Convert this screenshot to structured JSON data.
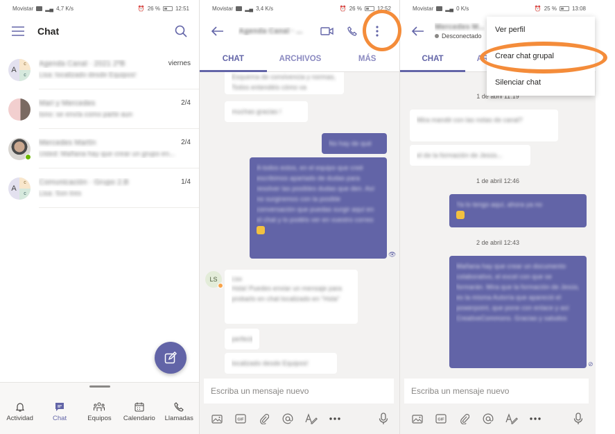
{
  "screen1": {
    "status": {
      "carrier": "Movistar",
      "speed": "4,7 K/s",
      "alarm_battery": "26 %",
      "time": "12:51"
    },
    "header": {
      "title": "Chat",
      "menu_icon": "hamburger-icon",
      "search_icon": "search-icon"
    },
    "chats": [
      {
        "name": "Agenda Canal · 2021 2ºB",
        "preview": "Lisa: localizado desde Equipos!",
        "date": "viernes",
        "avatar": "group",
        "initial": "A",
        "sub": "c"
      },
      {
        "name": "Mari y Mercedes",
        "preview": "tono: se envía como parte aun",
        "date": "2/4",
        "avatar": "photo"
      },
      {
        "name": "Mercedes Martín",
        "preview": "Usted: Mañana hay que crear un grupo en...",
        "date": "2/4",
        "avatar": "photo-online"
      },
      {
        "name": "Comunicación · Grupo 2.B",
        "preview": "Lisa: Son tres",
        "date": "1/4",
        "avatar": "group",
        "initial": "A",
        "sub": "c"
      }
    ],
    "fab_icon": "compose-icon",
    "nav": [
      {
        "label": "Actividad",
        "icon": "bell-icon"
      },
      {
        "label": "Chat",
        "icon": "chat-icon",
        "active": true
      },
      {
        "label": "Equipos",
        "icon": "teams-icon"
      },
      {
        "label": "Calendario",
        "icon": "calendar-icon"
      },
      {
        "label": "Llamadas",
        "icon": "phone-icon"
      }
    ]
  },
  "screen2": {
    "status": {
      "carrier": "Movistar",
      "speed": "3,4 K/s",
      "alarm_battery": "26 %",
      "time": "12:52"
    },
    "header": {
      "contact": "Agenda Canal · ..."
    },
    "tabs": [
      "CHAT",
      "ARCHIVOS",
      "MÁS"
    ],
    "messages": [
      {
        "dir": "in",
        "text": "Esquema de convivencia y normas, Todos entendéis cómo va"
      },
      {
        "dir": "in",
        "text": "muchas gracias !"
      },
      {
        "dir": "out",
        "text": "No hay de qué"
      },
      {
        "dir": "out",
        "text": "A todos estos, en el equipo que creé escribimos apartado de dudas para resolver las posibles dudas que den. Así no surgiremos con la posible conversación que puedas surgir aquí en el chat y lo podéis ver en vuestro correo"
      },
      {
        "sender": "LS",
        "sender_name": "Lisa",
        "dir": "in",
        "text": "Hola! Puedes enviar un mensaje para probarlo en chat localizado en \"Hola\""
      },
      {
        "dir": "in",
        "text": "perfecto"
      },
      {
        "dir": "in",
        "text": "localizado desde Equipos!"
      }
    ],
    "composer": {
      "placeholder": "Escriba un mensaje nuevo"
    }
  },
  "screen3": {
    "status": {
      "carrier": "Movistar",
      "speed": "0 K/s",
      "alarm_battery": "25 %",
      "time": "13:08"
    },
    "header": {
      "contact": "Mercedes M...",
      "presence": "Desconectado"
    },
    "tabs": [
      "CHAT",
      "ARCHIVOS"
    ],
    "menu": [
      "Ver perfil",
      "Crear chat grupal",
      "Silenciar chat"
    ],
    "highlighted_menu_item": "Crear chat grupal",
    "timestamps": [
      "1 de abril 11:19",
      "1 de abril 12:46",
      "2 de abril 12:43"
    ],
    "messages": [
      {
        "dir": "in",
        "text": "Mira mandé con las notas de canal?"
      },
      {
        "dir": "in",
        "text": "el de la formación de Jesús..."
      },
      {
        "dir": "out",
        "text": "Ya lo tengo aquí, ahora ya no"
      },
      {
        "dir": "out",
        "text": "Mañana hay que crear un documento colaborativo, el excel con que se formarán. Mira que la formación de Jesús, es la misma Autoría que apareció el powerpoint, que pone con enlace y así CreativeCommons. Gracias y saludos"
      }
    ],
    "composer": {
      "placeholder": "Escriba un mensaje nuevo"
    }
  },
  "annotations": {
    "color": "#f48c3a"
  },
  "colors": {
    "brand": "#6264a7",
    "background": "#f3f2f1"
  }
}
